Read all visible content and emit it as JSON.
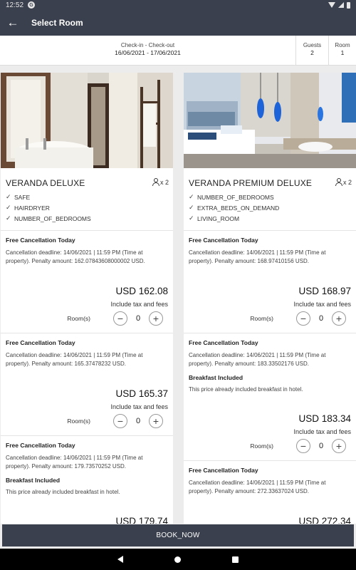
{
  "status_bar": {
    "time": "12:52",
    "notification_icon": "G"
  },
  "app_bar": {
    "back_icon": "←",
    "title": "Select Room"
  },
  "search_summary": {
    "dates_label": "Check-in - Check-out",
    "dates_value": "16/06/2021 - 17/06/2021",
    "guests_label": "Guests",
    "guests_value": "2",
    "room_label": "Room",
    "room_value": "1"
  },
  "rooms": [
    {
      "name": "VERANDA DELUXE",
      "capacity": "x 2",
      "amenities": [
        "SAFE",
        "HAIRDRYER",
        "NUMBER_OF_BEDROOMS"
      ],
      "offers": [
        {
          "title": "Free Cancellation Today",
          "description": "Cancellation deadline: 14/06/2021 | 11:59 PM (Time at property). Penalty amount: 162.07843608000002 USD.",
          "breakfast_title": "",
          "breakfast_desc": "",
          "price": "USD 162.08",
          "tax_note": "Include tax and fees",
          "rooms_label": "Room(s)",
          "quantity": "0"
        },
        {
          "title": "Free Cancellation Today",
          "description": "Cancellation deadline: 14/06/2021 | 11:59 PM (Time at property). Penalty amount: 165.37478232 USD.",
          "breakfast_title": "",
          "breakfast_desc": "",
          "price": "USD 165.37",
          "tax_note": "Include tax and fees",
          "rooms_label": "Room(s)",
          "quantity": "0"
        },
        {
          "title": "Free Cancellation Today",
          "description": "Cancellation deadline: 14/06/2021 | 11:59 PM (Time at property). Penalty amount: 179.73570252 USD.",
          "breakfast_title": "Breakfast Included",
          "breakfast_desc": "This price already included breakfast in hotel.",
          "price": "USD 179.74"
        }
      ]
    },
    {
      "name": "VERANDA PREMIUM DELUXE",
      "capacity": "x 2",
      "amenities": [
        "NUMBER_OF_BEDROOMS",
        "EXTRA_BEDS_ON_DEMAND",
        "LIVING_ROOM"
      ],
      "offers": [
        {
          "title": "Free Cancellation Today",
          "description": "Cancellation deadline: 14/06/2021 | 11:59 PM (Time at property). Penalty amount: 168.97410156 USD.",
          "breakfast_title": "",
          "breakfast_desc": "",
          "price": "USD 168.97",
          "tax_note": "Include tax and fees",
          "rooms_label": "Room(s)",
          "quantity": "0"
        },
        {
          "title": "Free Cancellation Today",
          "description": "Cancellation deadline: 14/06/2021 | 11:59 PM (Time at property). Penalty amount: 183.33502176 USD.",
          "breakfast_title": "Breakfast Included",
          "breakfast_desc": "This price already included breakfast in hotel.",
          "price": "USD 183.34",
          "tax_note": "Include tax and fees",
          "rooms_label": "Room(s)",
          "quantity": "0"
        },
        {
          "title": "Free Cancellation Today",
          "description": "Cancellation deadline: 14/06/2021 | 11:59 PM (Time at property). Penalty amount: 272.33637024 USD.",
          "breakfast_title": "",
          "breakfast_desc": "",
          "price": "USD 272.34"
        }
      ]
    }
  ],
  "book_button": {
    "label": "BOOK_NOW"
  },
  "colors": {
    "primary": "#3a404d",
    "background": "#ececec",
    "card": "#ffffff"
  },
  "icons": {
    "minus": "−",
    "plus": "+",
    "check": "✓"
  }
}
